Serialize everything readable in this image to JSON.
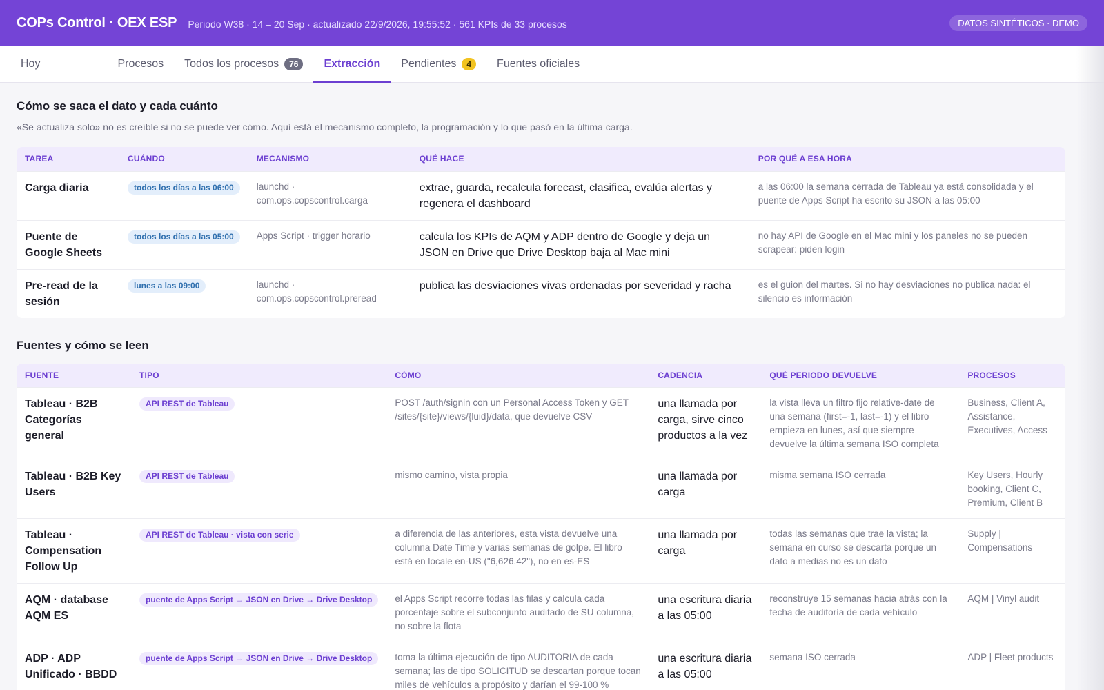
{
  "header": {
    "title": "COPs Control · OEX ESP",
    "meta": "Periodo W38 · 14 – 20 Sep · actualizado 22/9/2026, 19:55:52 · 561 KPIs de 33 procesos",
    "badge": "DATOS SINTÉTICOS · DEMO"
  },
  "tabs": [
    {
      "label": "Hoy"
    },
    {
      "label": "Procesos"
    },
    {
      "label": "Todos los procesos",
      "count": "76"
    },
    {
      "label": "Extracción"
    },
    {
      "label": "Pendientes",
      "count": "4"
    },
    {
      "label": "Fuentes oficiales"
    }
  ],
  "section1": {
    "title": "Cómo se saca el dato y cada cuánto",
    "description": "«Se actualiza solo» no es creíble si no se puede ver cómo. Aquí está el mecanismo completo, la programación y lo que pasó en la última carga.",
    "columns": [
      "TAREA",
      "CUÁNDO",
      "MECANISMO",
      "QUÉ HACE",
      "POR QUÉ A ESA HORA"
    ],
    "rows": [
      {
        "task": "Carga diaria",
        "when": "todos los días a las 06:00",
        "mechanism": "launchd · com.ops.copscontrol.carga",
        "what": "extrae, guarda, recalcula forecast, clasifica, evalúa alertas y regenera el dashboard",
        "why": "a las 06:00 la semana cerrada de Tableau ya está consolidada y el puente de Apps Script ha escrito su JSON a las 05:00"
      },
      {
        "task": "Puente de Google Sheets",
        "when": "todos los días a las 05:00",
        "mechanism": "Apps Script · trigger horario",
        "what": "calcula los KPIs de AQM y ADP dentro de Google y deja un JSON en Drive que Drive Desktop baja al Mac mini",
        "why": "no hay API de Google en el Mac mini y los paneles no se pueden scrapear: piden login"
      },
      {
        "task": "Pre-read de la sesión",
        "when": "lunes a las 09:00",
        "mechanism": "launchd · com.ops.copscontrol.preread",
        "what": "publica las desviaciones vivas ordenadas por severidad y racha",
        "why": "es el guion del martes. Si no hay desviaciones no publica nada: el silencio es información"
      }
    ]
  },
  "section2": {
    "title": "Fuentes y cómo se leen",
    "columns": [
      "FUENTE",
      "TIPO",
      "CÓMO",
      "CADENCIA",
      "QUÉ PERIODO DEVUELVE",
      "PROCESOS"
    ],
    "rows": [
      {
        "source": "Tableau · B2B Categorías general",
        "type": "API REST de Tableau",
        "how": "POST /auth/signin con un Personal Access Token y GET /sites/{site}/views/{luid}/data, que devuelve CSV",
        "cadence": "una llamada por carga, sirve cinco productos a la vez",
        "period": "la vista lleva un filtro fijo relative-date de una semana (first=-1, last=-1) y el libro empieza en lunes, así que siempre devuelve la última semana ISO completa",
        "processes": "Business, Client A, Assistance, Executives, Access"
      },
      {
        "source": "Tableau · B2B Key Users",
        "type": "API REST de Tableau",
        "how": "mismo camino, vista propia",
        "cadence": "una llamada por carga",
        "period": "misma semana ISO cerrada",
        "processes": "Key Users, Hourly booking, Client C, Premium, Client B"
      },
      {
        "source": "Tableau · Compensation Follow Up",
        "type": "API REST de Tableau · vista con serie",
        "how": "a diferencia de las anteriores, esta vista devuelve una columna Date Time y varias semanas de golpe. El libro está en locale en-US (\"6,626.42\"), no en es-ES",
        "cadence": "una llamada por carga",
        "period": "todas las semanas que trae la vista; la semana en curso se descarta porque un dato a medias no es un dato",
        "processes": "Supply | Compensations"
      },
      {
        "source": "AQM · database AQM ES",
        "type": "puente de Apps Script → JSON en Drive → Drive Desktop",
        "how": "el Apps Script recorre todas las filas y calcula cada porcentaje sobre el subconjunto auditado de SU columna, no sobre la flota",
        "cadence": "una escritura diaria a las 05:00",
        "period": "reconstruye 15 semanas hacia atrás con la fecha de auditoría de cada vehículo",
        "processes": "AQM | Vinyl audit"
      },
      {
        "source": "ADP · ADP Unificado · BBDD",
        "type": "puente de Apps Script → JSON en Drive → Drive Desktop",
        "how": "toma la última ejecución de tipo AUDITORIA de cada semana; las de tipo SOLICITUD se descartan porque tocan miles de vehículos a propósito y darían el 99-100 %",
        "cadence": "una escritura diaria a las 05:00",
        "period": "semana ISO cerrada",
        "processes": "ADP | Fleet products"
      }
    ]
  }
}
